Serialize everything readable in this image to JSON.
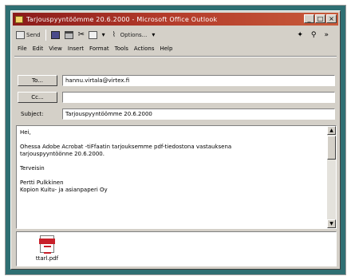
{
  "window": {
    "title": "Tarjouspyyntöömme 20.6.2000 - Microsoft Office Outlook",
    "controls": {
      "minimize": "_",
      "maximize": "□",
      "close": "×"
    }
  },
  "toolbar": {
    "send": "Send",
    "options": "Options..."
  },
  "menu": [
    "File",
    "Edit",
    "View",
    "Insert",
    "Format",
    "Tools",
    "Actions",
    "Help"
  ],
  "header": {
    "to_label": "To...",
    "to_value": "hannu.virtala@virtex.fi",
    "cc_label": "Cc...",
    "cc_value": "",
    "subject_label": "Subject:",
    "subject_value": "Tarjouspyyntöömme 20.6.2000"
  },
  "message": {
    "greeting": "Hei,",
    "para1a": "Ohessa Adobe Acrobat -tiFfaatin tarjouksemme pdf-tiedostona vastauksena",
    "para1b": "tarjouspyyntöönne 20.6.2000.",
    "closing": "Terveisin",
    "sender_name": "Pertti Pulkkinen",
    "sender_company": "Kopion Kuitu- ja asianpaperi Oy"
  },
  "attachment": {
    "name": "ttarl.pdf",
    "icon": "pdf-file-icon"
  },
  "colors": {
    "titlebar": "#8a1a1a",
    "chrome": "#d4d0c8",
    "desktop": "#2f6f73"
  }
}
